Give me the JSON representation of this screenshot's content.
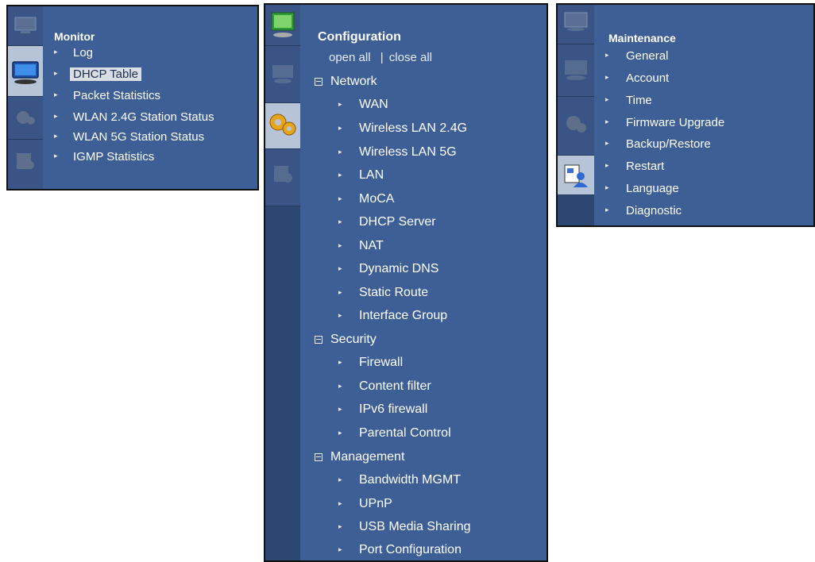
{
  "monitor": {
    "title": "Monitor",
    "items": [
      {
        "label": "Log"
      },
      {
        "label": "DHCP Table"
      },
      {
        "label": "Packet Statistics"
      },
      {
        "label": "WLAN 2.4G Station Status"
      },
      {
        "label": "WLAN 5G Station Status"
      },
      {
        "label": "IGMP Statistics"
      }
    ]
  },
  "configuration": {
    "title": "Configuration",
    "open_all": "open all",
    "separator": "|",
    "close_all": "close all",
    "groups": {
      "network": {
        "label": "Network",
        "items": [
          "WAN",
          "Wireless LAN 2.4G",
          "Wireless LAN 5G",
          "LAN",
          "MoCA",
          "DHCP Server",
          "NAT",
          "Dynamic DNS",
          "Static Route",
          "Interface Group"
        ]
      },
      "security": {
        "label": "Security",
        "items": [
          "Firewall",
          "Content filter",
          "IPv6 firewall",
          "Parental Control"
        ]
      },
      "management": {
        "label": "Management",
        "items": [
          "Bandwidth MGMT",
          "UPnP",
          "USB Media Sharing",
          "Port Configuration"
        ]
      }
    }
  },
  "maintenance": {
    "title": "Maintenance",
    "items": [
      "General",
      "Account",
      "Time",
      "Firmware Upgrade",
      "Backup/Restore",
      "Restart",
      "Language",
      "Diagnostic"
    ]
  },
  "rail_icons": [
    "monitor-icon",
    "configuration-gear-icon",
    "maintenance-user-icon"
  ],
  "colors": {
    "panel": "#3d5f96",
    "rail": "#2d4773",
    "highlight": "#d9dde4"
  }
}
